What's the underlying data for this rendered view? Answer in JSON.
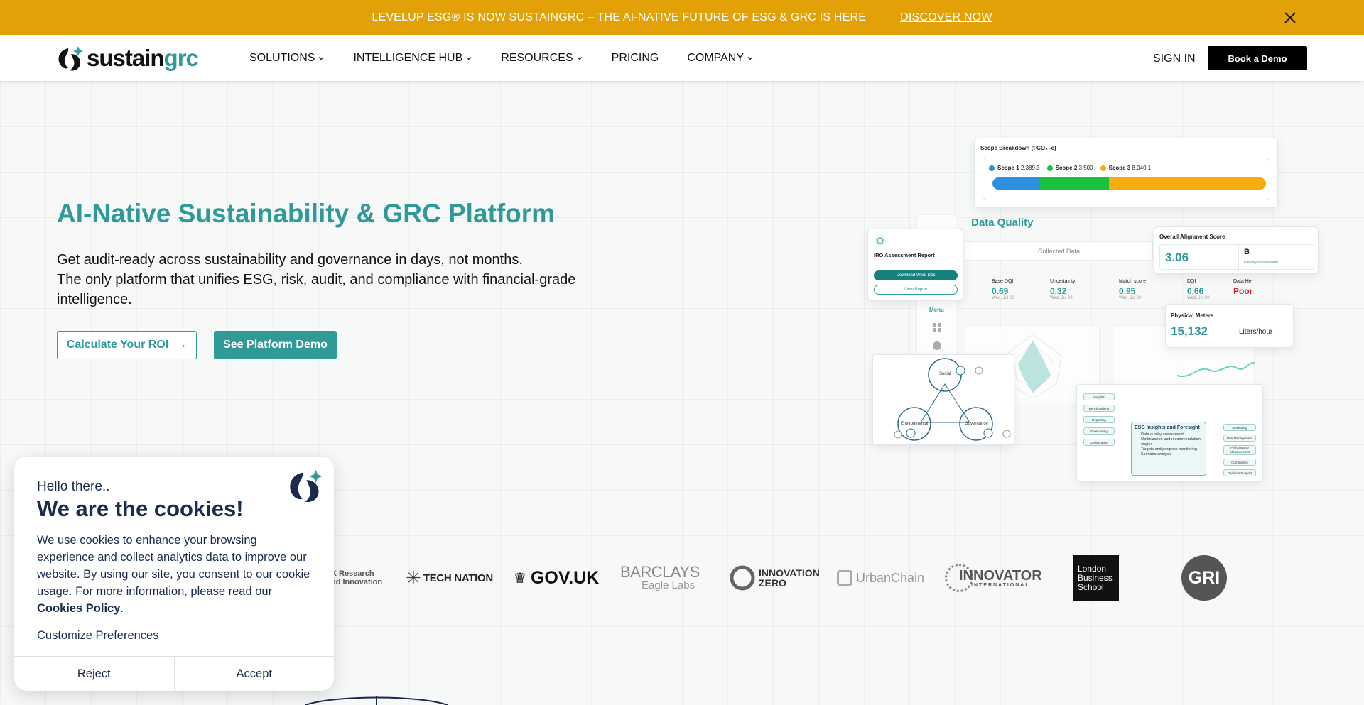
{
  "announcement": {
    "text": "LEVELUP ESG® IS NOW SUSTAINGRC – THE AI-NATIVE FUTURE OF ESG & GRC IS HERE",
    "link": "DISCOVER NOW",
    "bg_color": "#e2a106"
  },
  "header": {
    "logo_main": "sustain",
    "logo_accent": "grc",
    "nav": [
      "SOLUTIONS",
      "INTELLIGENCE HUB",
      "RESOURCES",
      "PRICING",
      "COMPANY"
    ],
    "signin": "SIGN IN",
    "book_demo": "Book a Demo"
  },
  "hero": {
    "title": "AI-Native Sustainability & GRC Platform",
    "subtitle_line1": "Get audit-ready across sustainability and governance in days, not months.",
    "subtitle_line2": "The only platform that unifies ESG, risk, audit, and compliance with financial-grade intelligence.",
    "btn_roi": "Calculate Your ROI",
    "btn_roi_icon": "arrow-right-icon",
    "btn_demo": "See Platform Demo",
    "accent_color": "#2f9a98"
  },
  "dashboard": {
    "scope": {
      "title": "Scope Breakdown (t CO₂ -e)",
      "items": [
        {
          "label": "Scope 1",
          "value": "2,389.3",
          "color": "#2d8fe0",
          "fraction": 0.173
        },
        {
          "label": "Scope 2",
          "value": "3,500",
          "color": "#19c040",
          "fraction": 0.254
        },
        {
          "label": "Scope 3",
          "value": "8,040.1",
          "color": "#f5ac0c",
          "fraction": 0.573
        }
      ]
    },
    "data_quality": {
      "title": "Data Quality",
      "collected": "Collected Data",
      "metrics": [
        {
          "label": "Base DQI",
          "value": "0.69",
          "date": "Wed, Jul 20"
        },
        {
          "label": "Uncertainty",
          "value": "0.32",
          "date": "Wed, Jul 20"
        },
        {
          "label": "Match score",
          "value": "0.95",
          "date": "Wed, Jul 20"
        },
        {
          "label": "DQI",
          "value": "0.66",
          "date": "Wed, Jul 20"
        },
        {
          "label": "Data He",
          "value": "Poor",
          "date": ""
        }
      ]
    },
    "iro": {
      "title": "IRO Assessment Report",
      "download": "Download Word Doc",
      "view": "View Report"
    },
    "menu_label": "Menu",
    "alignment": {
      "title": "Overall Alignment Score",
      "score": "3.06",
      "grade": "B",
      "grade_note": "Partially Implemented"
    },
    "meters": {
      "title": "Physical Meters",
      "value": "15,132",
      "unit": "Liters/hour"
    },
    "venn": {
      "social": "Social",
      "environmental": "Environmental",
      "governance": "Governance"
    },
    "insights": {
      "title": "ESG Insights and Foresight",
      "bullets": [
        "Data quality assessment",
        "Optimization and recommendation engine",
        "Targets and progress monitoring",
        "Scenario analysis"
      ],
      "left_tags": [
        "Insights",
        "Benchmarking",
        "Reporting",
        "Forecasting",
        "Optimization"
      ],
      "right_tags": [
        "Monitoring",
        "Risk Management",
        "Performance Measurement",
        "Compliance",
        "Decision Support"
      ]
    }
  },
  "partners": {
    "ukri_line1": "K Research",
    "ukri_line2": "nd Innovation",
    "tech_nation": "TECH NATION",
    "govuk": "GOV.UK",
    "barclays": "BARCLAYS",
    "barclays_sub": "Eagle Labs",
    "innovation_zero_1": "INNOVATION",
    "innovation_zero_2": "ZERO",
    "urbanchain": "UrbanChain",
    "innovator": "INNOVATOR",
    "innovator_sub": "INTERNATIONAL",
    "lbs": [
      "London",
      "Business",
      "School"
    ],
    "gri": "GRI"
  },
  "cookie": {
    "hello": "Hello there..",
    "title": "We are the cookies!",
    "body": "We use cookies to enhance your browsing experience and collect analytics data to improve our website. By using our site, you consent to our cookie usage. For more information, please read our",
    "policy_link": "Cookies Policy",
    "customize": "Customize Preferences",
    "reject": "Reject",
    "accept": "Accept"
  }
}
